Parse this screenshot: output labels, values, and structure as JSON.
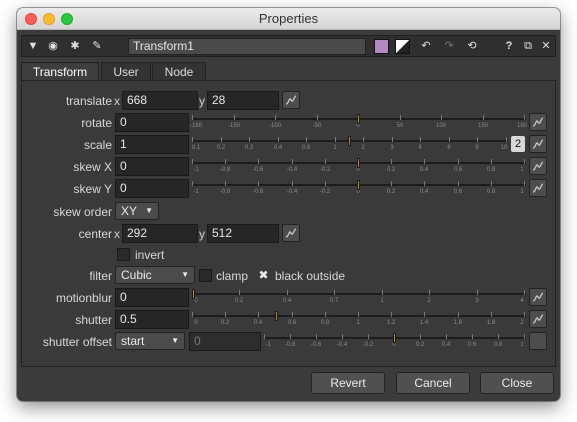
{
  "window": {
    "title": "Properties"
  },
  "toolbar": {
    "node_name": "Transform1",
    "icons": [
      "triangle-down-icon",
      "center-node-icon",
      "float-icon",
      "wrench-icon",
      "color-swatch-icon",
      "white-swatch-icon",
      "undo-icon",
      "redo-icon",
      "revert-icon",
      "help-icon",
      "maximize-icon",
      "close-icon"
    ],
    "help_label": "?",
    "close_label": "✕"
  },
  "tabs": [
    {
      "label": "Transform",
      "active": true
    },
    {
      "label": "User",
      "active": false
    },
    {
      "label": "Node",
      "active": false
    }
  ],
  "knobs": {
    "translate": {
      "label": "translate",
      "x_label": "x",
      "x": "668",
      "y_label": "y",
      "y": "28"
    },
    "rotate": {
      "label": "rotate",
      "value": "0",
      "ticks": [
        "-180",
        "-150",
        "-100",
        "-50",
        "0",
        "50",
        "100",
        "150",
        "180"
      ],
      "level": 0.5
    },
    "scale": {
      "label": "scale",
      "value": "1",
      "badge": "2",
      "ticks": [
        "0.1",
        "0.2",
        "0.3",
        "0.4",
        "0.6",
        "1",
        "2",
        "3",
        "4",
        "6",
        "8",
        "10"
      ],
      "level": 0.5
    },
    "skew_x": {
      "label": "skew X",
      "value": "0",
      "ticks": [
        "-1",
        "-0.8",
        "-0.6",
        "-0.4",
        "-0.2",
        "0",
        "0.2",
        "0.4",
        "0.6",
        "0.8",
        "1"
      ],
      "level": 0.5
    },
    "skew_y": {
      "label": "skew Y",
      "value": "0",
      "ticks": [
        "-1",
        "-0.8",
        "-0.6",
        "-0.4",
        "-0.2",
        "0",
        "0.2",
        "0.4",
        "0.6",
        "0.8",
        "1"
      ],
      "level": 0.5
    },
    "skew_order": {
      "label": "skew order",
      "value": "XY"
    },
    "center": {
      "label": "center",
      "x_label": "x",
      "x": "292",
      "y_label": "y",
      "y": "512"
    },
    "invert": {
      "label": "invert"
    },
    "filter": {
      "label": "filter",
      "value": "Cubic",
      "clamp_label": "clamp",
      "black_outside_label": "black outside",
      "check_mark": "✖"
    },
    "motionblur": {
      "label": "motionblur",
      "value": "0",
      "ticks": [
        "0",
        "0.2",
        "0.4",
        "0.7",
        "1",
        "2",
        "3",
        "4"
      ],
      "level": 0.0
    },
    "shutter": {
      "label": "shutter",
      "value": "0.5",
      "ticks": [
        "0",
        "0.2",
        "0.4",
        "0.6",
        "0.8",
        "1",
        "1.2",
        "1.4",
        "1.6",
        "1.8",
        "2"
      ],
      "level": 0.25
    },
    "shutter_offset": {
      "label": "shutter offset",
      "mode": "start",
      "value": "0",
      "ticks": [
        "-1",
        "-0.8",
        "-0.6",
        "-0.4",
        "-0.2",
        "0",
        "0.2",
        "0.4",
        "0.6",
        "0.8",
        "1"
      ],
      "level": 0.5
    }
  },
  "buttons": {
    "revert": "Revert",
    "cancel": "Cancel",
    "close": "Close"
  },
  "colors": {
    "accent_knob": "#b08a3c",
    "swatch_purple": "#b48ac4",
    "panel_bg": "#3a3a3a"
  }
}
